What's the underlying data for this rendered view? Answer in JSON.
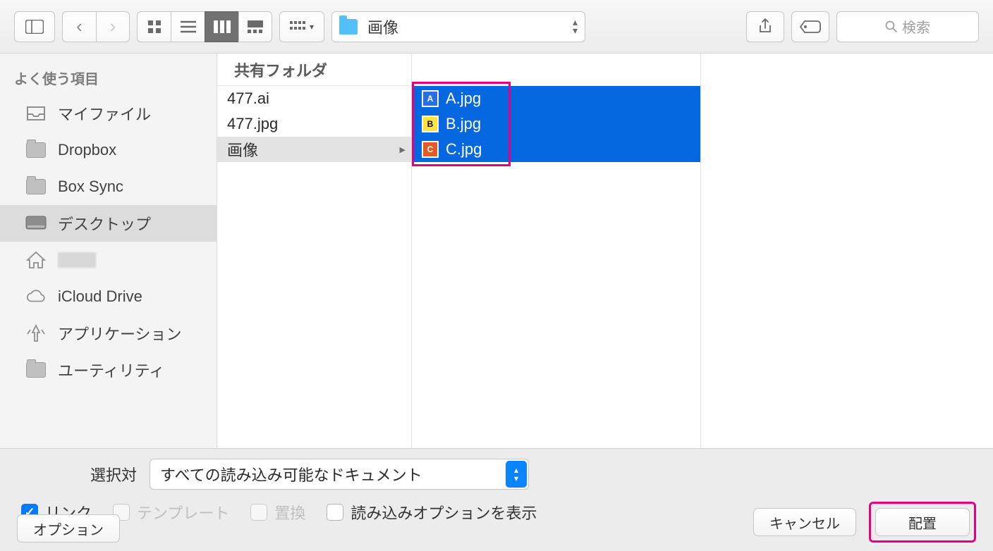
{
  "toolbar": {
    "path_label": "画像",
    "arrange_glyph": "⊞⊞",
    "search_placeholder": "検索"
  },
  "sidebar": {
    "section": "よく使う項目",
    "items": [
      {
        "icon": "tray",
        "label": "マイファイル"
      },
      {
        "icon": "folder",
        "label": "Dropbox"
      },
      {
        "icon": "folder",
        "label": "Box Sync"
      },
      {
        "icon": "desktop",
        "label": "デスクトップ",
        "selected": true
      },
      {
        "icon": "home",
        "label": ""
      },
      {
        "icon": "cloud",
        "label": "iCloud Drive"
      },
      {
        "icon": "apps",
        "label": "アプリケーション"
      },
      {
        "icon": "folder",
        "label": "ユーティリティ"
      }
    ]
  },
  "columns": {
    "col1": {
      "header": "共有フォルダ",
      "rows": [
        {
          "label": "477.ai"
        },
        {
          "label": "477.jpg"
        },
        {
          "label": "画像",
          "isFolder": true,
          "navSelected": true
        }
      ]
    },
    "col2": {
      "rows": [
        {
          "label": "A.jpg",
          "thumb": "A",
          "selected": true
        },
        {
          "label": "B.jpg",
          "thumb": "B",
          "selected": true
        },
        {
          "label": "C.jpg",
          "thumb": "C",
          "selected": true
        }
      ]
    }
  },
  "bottom": {
    "select_label": "選択対",
    "select_value": "すべての読み込み可能なドキュメント",
    "checkboxes": {
      "link": {
        "label": "リンク",
        "checked": true,
        "enabled": true
      },
      "template": {
        "label": "テンプレート",
        "checked": false,
        "enabled": false
      },
      "replace": {
        "label": "置換",
        "checked": false,
        "enabled": false
      },
      "showopts": {
        "label": "読み込みオプションを表示",
        "checked": false,
        "enabled": true
      }
    },
    "options_btn": "オプション",
    "cancel_btn": "キャンセル",
    "place_btn": "配置"
  }
}
